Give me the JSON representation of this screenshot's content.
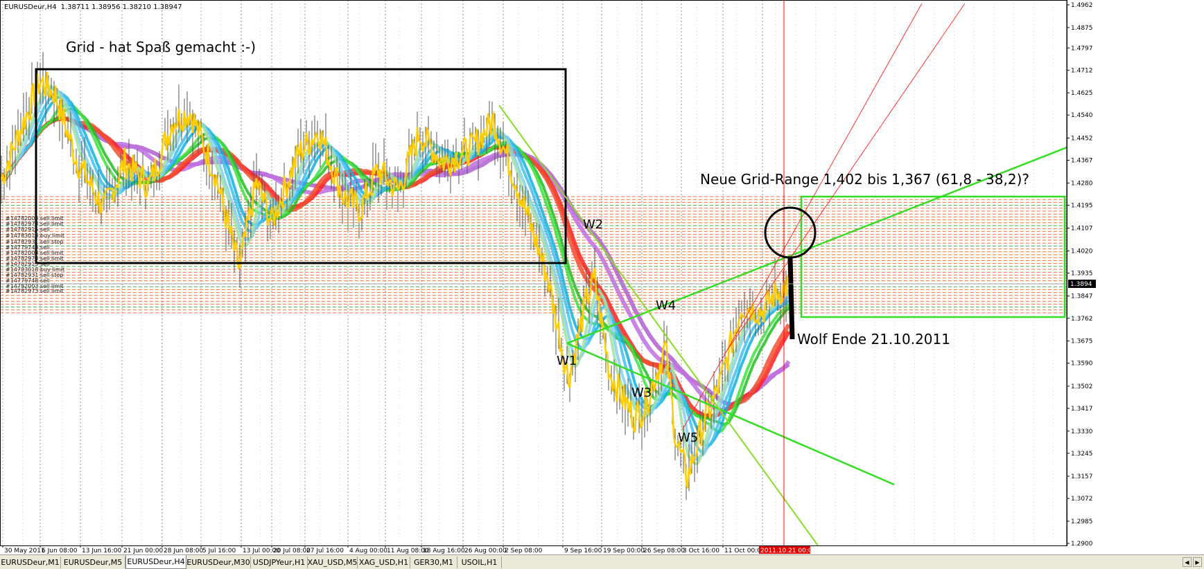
{
  "header": {
    "symbol": "EURUSDeur,H4",
    "ohlc": "1.38711 1.38956 1.38210 1.38947"
  },
  "annotations": {
    "grid_title": "Grid - hat Spaß gemacht :-)",
    "new_grid": "Neue Grid-Range 1,402 bis 1,367 (61,8 - 38,2)?",
    "wolf_end": "Wolf Ende 21.10.2011",
    "waves": [
      "W1",
      "W2",
      "W3",
      "W4",
      "W5"
    ]
  },
  "orders": [
    "#14782003 sell limit",
    "#14782973 sell limit",
    "#14782915 sell",
    "#14783018 buy limit",
    "#14782931 sell stop",
    "#14779748 sell"
  ],
  "price_axis": {
    "labels": [
      "1.4962",
      "1.4875",
      "1.4797",
      "1.4712",
      "1.4625",
      "1.4540",
      "1.4452",
      "1.4367",
      "1.4280",
      "1.4195",
      "1.4107",
      "1.4020",
      "1.3935",
      "1.3847",
      "1.3762",
      "1.3675",
      "1.3590",
      "1.3502",
      "1.3417",
      "1.3330",
      "1.3245",
      "1.3157",
      "1.3072",
      "1.2985",
      "1.2900"
    ],
    "current_price": "1.3894"
  },
  "time_axis": {
    "labels": [
      "30 May 2011",
      "6 Jun 08:00",
      "13 Jun 16:00",
      "21 Jun 00:00",
      "28 Jun 08:00",
      "5 Jul 16:00",
      "13 Jul 00:00",
      "20 Jul 08:00",
      "27 Jul 16:00",
      "4 Aug 00:00",
      "11 Aug 08:00",
      "18 Aug 16:00",
      "26 Aug 00:00",
      "2 Sep 08:00",
      "9 Sep 16:00",
      "19 Sep 00:00",
      "26 Sep 08:00",
      "3 Oct 16:00",
      "11 Oct 00:00"
    ],
    "highlight": "2011.10.21 00:00"
  },
  "tabs": [
    "EURUSDeur,M1",
    "EURUSDeur,M5",
    "EURUSDeur,H4",
    "EURUSDeur,M30",
    "USDJPYeur,H1",
    "XAU_USD,M5",
    "XAG_USD,H1",
    "GER30,M1",
    "USOIL,H1"
  ],
  "active_tab": 2,
  "colors": {
    "bull_frame": "#000000",
    "grid_box": "#33dd22",
    "red_line": "#ff0000",
    "price_line": "#ffcc00",
    "bg": "#ffffff"
  },
  "icons": [
    "scroll-left-icon",
    "scroll-right-icon"
  ]
}
